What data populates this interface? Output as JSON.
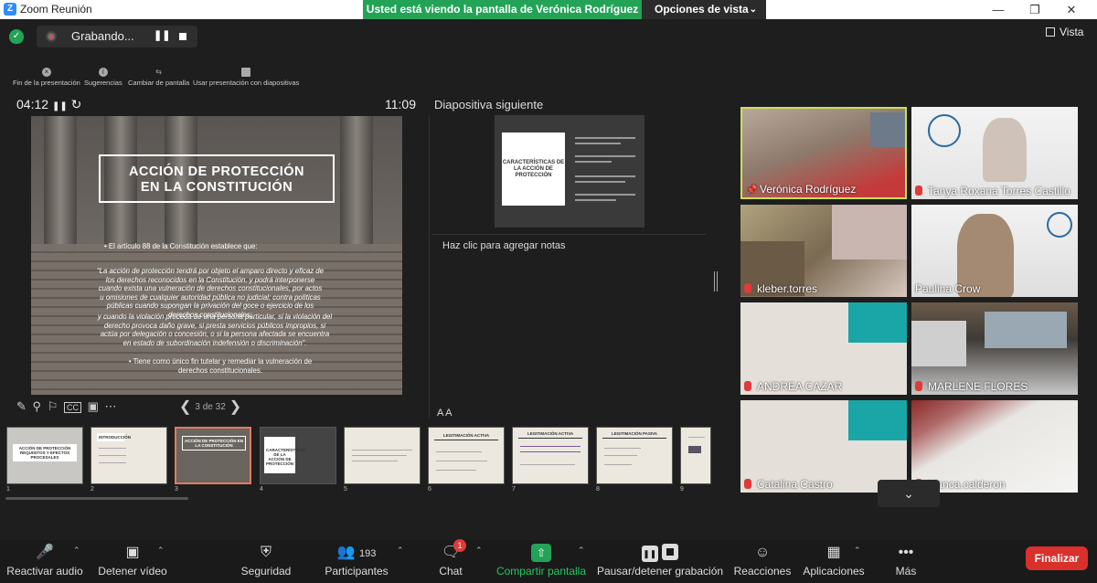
{
  "window": {
    "title": "Zoom Reunión",
    "viewing_banner": "Usted está viendo la pantalla de Verónica Rodríguez",
    "view_options": "Opciones de vista"
  },
  "recording": {
    "label": "Grabando..."
  },
  "vista": "Vista",
  "presenter_toolbar": [
    "Fin de la presentación",
    "Sugerencias",
    "Cambiar de pantalla",
    "Usar presentación con diapositivas"
  ],
  "timer": "04:12",
  "clock": "11:09",
  "next_slide_label": "Diapositiva siguiente",
  "current_slide": {
    "title_line1": "ACCIÓN DE PROTECCIÓN",
    "title_line2": "EN LA CONSTITUCIÓN",
    "bullet1": "El artículo 88 de la Constitución establece que:",
    "quote1": "“La acción de protección tendrá por objeto el amparo directo y eficaz de los derechos reconocidos en la Constitución, y podrá interponerse cuando exista una vulneración de derechos constitucionales, por actos u omisiones de cualquier autoridad pública no judicial; contra políticas públicas cuando supongan la privación del goce o ejercicio de los derechos constitucionales;",
    "quote2": "y cuando la violación proceda de una persona particular, si la violación del derecho provoca daño grave, si presta servicios públicos impropios, si actúa por delegación o concesión, o si la persona afectada se encuentra en estado de subordinación indefensión o discriminación”.",
    "bullet2": "Tiene como único fin tutelar y remediar la vulneración de derechos constitucionales."
  },
  "next_slide": {
    "title": "CARACTERÍSTICAS DE LA ACCIÓN DE PROTECCIÓN"
  },
  "notes_placeholder": "Haz clic para agregar notas",
  "font_controls": "A  A",
  "pager": "3 de 32",
  "thumbnails": [
    {
      "num": "1",
      "title": "ACCIÓN DE PROTECCIÓN REQUISITOS Y EFECTOS PROCESALES"
    },
    {
      "num": "2",
      "title": "INTRODUCCIÓN"
    },
    {
      "num": "3",
      "title": "ACCIÓN DE PROTECCIÓN EN LA CONSTITUCIÓN"
    },
    {
      "num": "4",
      "title": "CARACTERÍSTICAS DE LA ACCIÓN DE PROTECCIÓN"
    },
    {
      "num": "5",
      "title": ""
    },
    {
      "num": "6",
      "title": "LEGITIMACIÓN ACTIVA"
    },
    {
      "num": "7",
      "title": "LEGITIMACIÓN ACTIVA"
    },
    {
      "num": "8",
      "title": "LEGITIMACIÓN PASIVA"
    },
    {
      "num": "9",
      "title": ""
    }
  ],
  "participants": [
    {
      "name": "Verónica Rodríguez",
      "status": "pinned"
    },
    {
      "name": "Tanya Roxana Torres Castillo",
      "status": "muted"
    },
    {
      "name": "kleber.torres",
      "status": "muted"
    },
    {
      "name": "Paulina Crow",
      "status": "none"
    },
    {
      "name": "ANDREA CAZAR",
      "status": "muted"
    },
    {
      "name": "MARLENE FLORES",
      "status": "muted"
    },
    {
      "name": "Catalina Castro",
      "status": "muted"
    },
    {
      "name": "blanca.calderon",
      "status": "muted"
    }
  ],
  "bottom_bar": {
    "unmute": "Reactivar audio",
    "stop_video": "Detener vídeo",
    "security": "Seguridad",
    "participants": "Participantes",
    "participants_count": "193",
    "chat": "Chat",
    "chat_badge": "1",
    "share": "Compartir pantalla",
    "pause_recording": "Pausar/detener grabación",
    "reactions": "Reacciones",
    "apps": "Aplicaciones",
    "more": "Más",
    "end": "Finalizar"
  },
  "colors": {
    "accent_green": "#23a357",
    "end_red": "#d9302b",
    "zoom_blue": "#2d8cff"
  }
}
